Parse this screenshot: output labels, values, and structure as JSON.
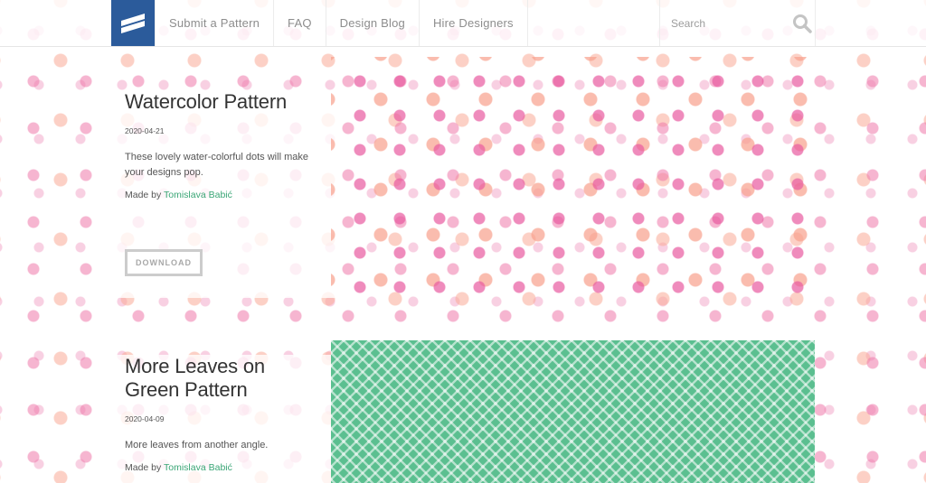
{
  "header": {
    "nav": [
      "Submit a Pattern",
      "FAQ",
      "Design Blog",
      "Hire Designers"
    ],
    "search_placeholder": "Search"
  },
  "patterns": [
    {
      "title": "Watercolor Pattern",
      "date": "2020-04-21",
      "description": "These lovely water-colorful dots will make your designs pop.",
      "made_by_label": "Made by",
      "author": "Tomislava Babić",
      "download_label": "DOWNLOAD"
    },
    {
      "title": "More Leaves on Green Pattern",
      "date": "2020-04-09",
      "description": "More leaves from another angle.",
      "made_by_label": "Made by",
      "author": "Tomislava Babić"
    }
  ],
  "colors": {
    "logo_bg": "#2b5b9b",
    "author_link": "#3aa676",
    "green_pattern": "#5bbf90"
  }
}
